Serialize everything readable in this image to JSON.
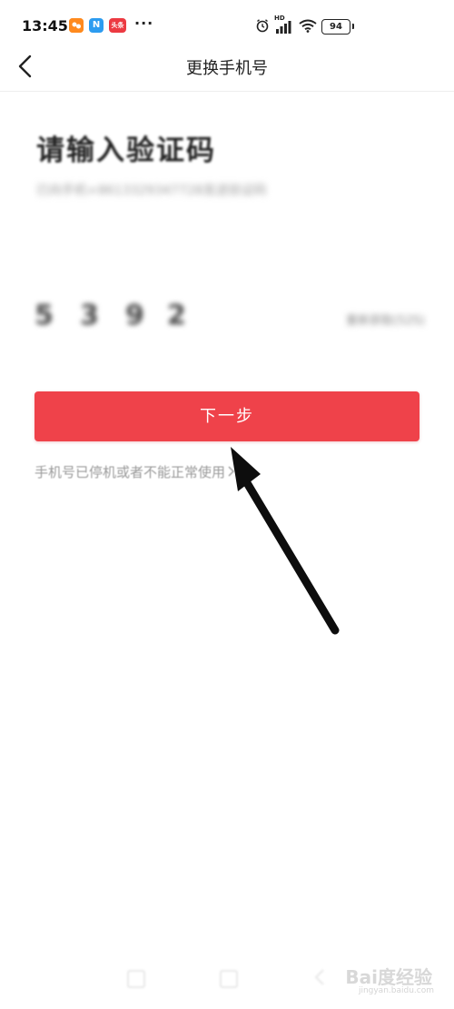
{
  "status_bar": {
    "time": "13:45",
    "app_icons": [
      {
        "name": "taobao-app-icon",
        "label": "",
        "color": "#ff8a1e"
      },
      {
        "name": "n-app-icon",
        "label": "N",
        "color": "#2d9cf0"
      },
      {
        "name": "toutiao-app-icon",
        "label": "头条",
        "color": "#ec3a42"
      }
    ],
    "overflow": "···",
    "hd_label": "HD",
    "battery_level": "94"
  },
  "nav": {
    "title": "更换手机号",
    "back_icon": "chevron-left-icon"
  },
  "content": {
    "heading": "请输入验证码",
    "subtitle": "已向手机+8613329347728发送验证码",
    "code_digits": [
      "5",
      "3",
      "9",
      "2"
    ],
    "resend_label": "重新获取(52S)",
    "next_button": "下一步",
    "help_link": "手机号已停机或者不能正常使用",
    "help_chevron": "chevron-right-icon"
  },
  "overlay": {
    "arrow": "annotation-arrow",
    "watermark": "Bai度经验",
    "watermark_sub": "jingyan.baidu.com"
  },
  "colors": {
    "accent": "#ef424a",
    "background": "#ffffff"
  }
}
